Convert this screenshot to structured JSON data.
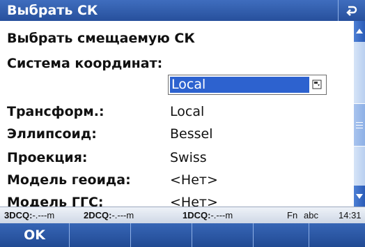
{
  "window": {
    "title": "Выбрать СК"
  },
  "content": {
    "heading": "Выбрать смещаемую СК",
    "coord_system": {
      "label": "Система координат:",
      "selected": "Local"
    },
    "fields": [
      {
        "label": "Трансформ.:",
        "value": "Local"
      },
      {
        "label": "Эллипсоид:",
        "value": "Bessel"
      },
      {
        "label": "Проекция:",
        "value": "Swiss"
      },
      {
        "label": "Модель геоида:",
        "value": "<Нет>"
      },
      {
        "label": "Модель ГГС:",
        "value": "<Нет>"
      }
    ]
  },
  "status_bar": {
    "q3_label": "3DCQ:",
    "q3_value": "-.---m",
    "q2_label": "2DCQ:",
    "q2_value": "-.---m",
    "q1_label": "1DCQ:",
    "q1_value": "-.---m",
    "fn": "Fn",
    "input_mode": "abc",
    "time": "14:31"
  },
  "softkeys": {
    "f1": "OK"
  },
  "colors": {
    "titlebar": "#2f5cae",
    "selection": "#2d62cf"
  },
  "icons": {
    "back": "back-arrow-icon",
    "dropdown": "dropdown-list-icon"
  }
}
